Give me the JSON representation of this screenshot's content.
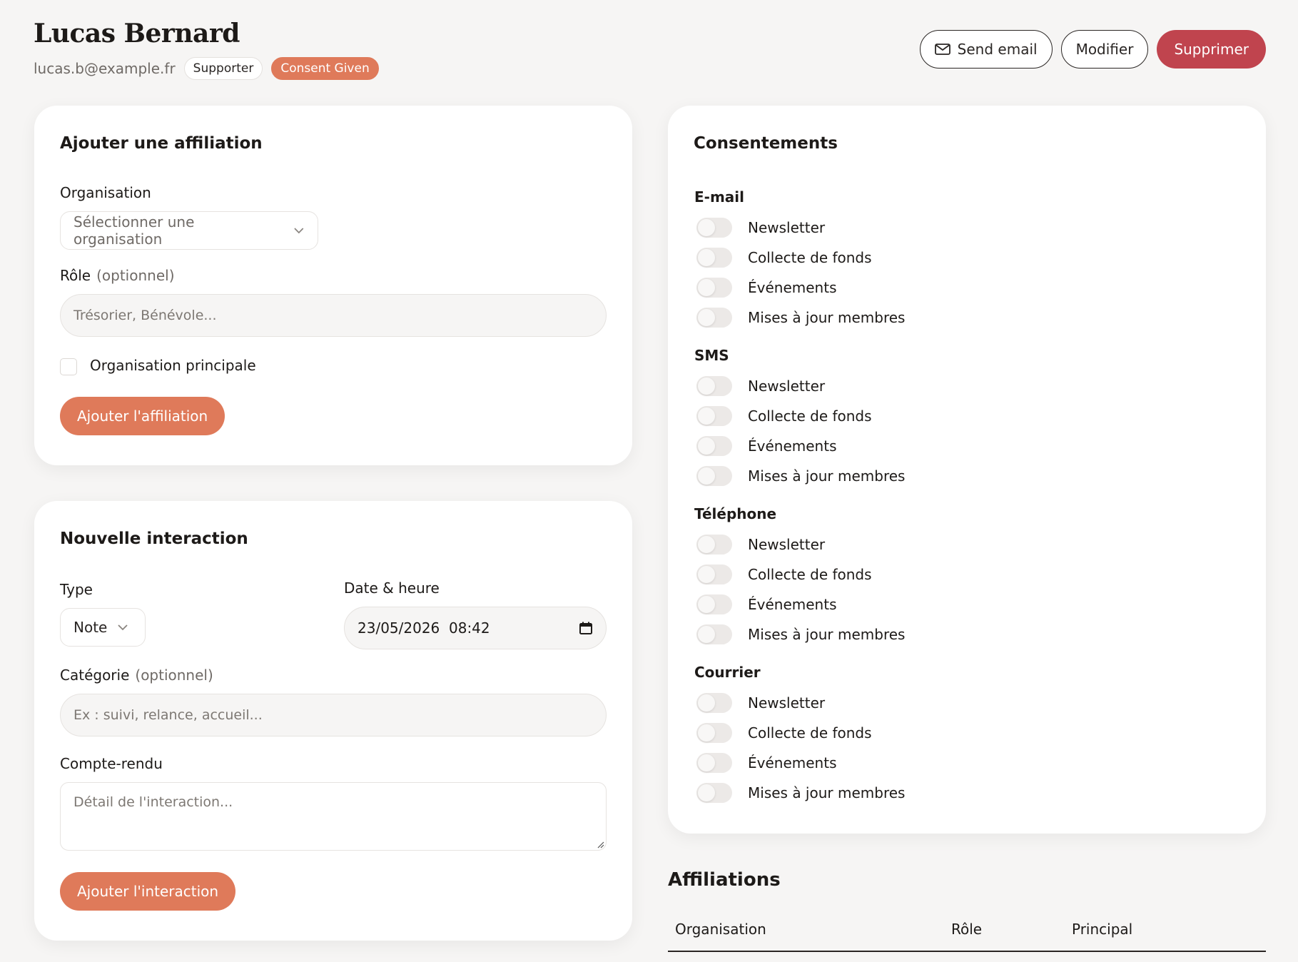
{
  "contact": {
    "name": "Lucas Bernard",
    "email": "lucas.b@example.fr",
    "badges": [
      "Supporter",
      "Consent Given"
    ]
  },
  "actions": {
    "send_email": "Send email",
    "edit": "Modifier",
    "delete": "Supprimer"
  },
  "affiliation_form": {
    "title": "Ajouter une affiliation",
    "org_label": "Organisation",
    "org_placeholder": "Sélectionner une organisation",
    "role_label": "Rôle",
    "role_optional": "(optionnel)",
    "role_placeholder": "Trésorier, Bénévole...",
    "primary_label": "Organisation principale",
    "submit": "Ajouter l'affiliation"
  },
  "interaction_form": {
    "title": "Nouvelle interaction",
    "type_label": "Type",
    "type_value": "Note",
    "datetime_label": "Date & heure",
    "datetime_value": "23/05/2026  08:42",
    "category_label": "Catégorie",
    "category_optional": "(optionnel)",
    "category_placeholder": "Ex : suivi, relance, accueil...",
    "report_label": "Compte-rendu",
    "report_placeholder": "Détail de l'interaction...",
    "submit": "Ajouter l'interaction"
  },
  "consents": {
    "title": "Consentements",
    "groups": [
      {
        "name": "E-mail",
        "items": [
          "Newsletter",
          "Collecte de fonds",
          "Événements",
          "Mises à jour membres"
        ]
      },
      {
        "name": "SMS",
        "items": [
          "Newsletter",
          "Collecte de fonds",
          "Événements",
          "Mises à jour membres"
        ]
      },
      {
        "name": "Téléphone",
        "items": [
          "Newsletter",
          "Collecte de fonds",
          "Événements",
          "Mises à jour membres"
        ]
      },
      {
        "name": "Courrier",
        "items": [
          "Newsletter",
          "Collecte de fonds",
          "Événements",
          "Mises à jour membres"
        ]
      }
    ]
  },
  "affiliations": {
    "title": "Affiliations",
    "columns": [
      "Organisation",
      "Rôle",
      "Principal"
    ]
  },
  "colors": {
    "accent": "#df7a5a",
    "danger": "#c0444e",
    "background": "#f6f5f4"
  }
}
